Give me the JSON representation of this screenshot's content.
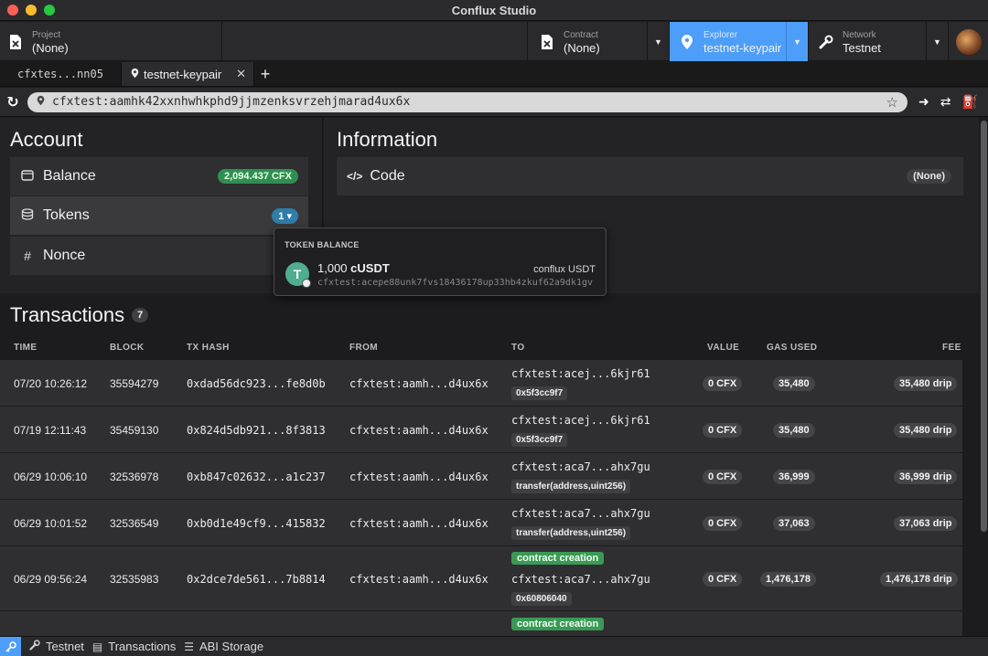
{
  "window": {
    "title": "Conflux Studio"
  },
  "toolbar": {
    "project_label": "Project",
    "project_value": "(None)",
    "contract_label": "Contract",
    "contract_value": "(None)",
    "explorer_label": "Explorer",
    "explorer_value": "testnet-keypair",
    "network_label": "Network",
    "network_value": "Testnet"
  },
  "tabs": [
    {
      "label": "cfxtes...nn05"
    },
    {
      "label": "testnet-keypair"
    }
  ],
  "address": {
    "value": "cfxtest:aamhk42xxnhwhkphd9jjmzenksvrzehjmarad4ux6x"
  },
  "account": {
    "title": "Account",
    "balance_label": "Balance",
    "balance_value": "2,094.437 CFX",
    "tokens_label": "Tokens",
    "tokens_value": "1",
    "nonce_label": "Nonce"
  },
  "information": {
    "title": "Information",
    "code_label": "Code",
    "code_value": "(None)"
  },
  "token_popup": {
    "header": "TOKEN BALANCE",
    "amount": "1,000",
    "symbol": "cUSDT",
    "name": "conflux USDT",
    "address": "cfxtest:acepe88unk7fvs18436178up33hb4zkuf62a9dk1gv"
  },
  "transactions": {
    "title": "Transactions",
    "count": "7",
    "columns": [
      "TIME",
      "BLOCK",
      "TX HASH",
      "FROM",
      "TO",
      "VALUE",
      "GAS USED",
      "FEE"
    ],
    "rows": [
      {
        "time": "07/20 10:26:12",
        "block": "35594279",
        "hash": "0xdad56dc923...fe8d0b",
        "from": "cfxtest:aamh...d4ux6x",
        "to": "cfxtest:acej...6kjr61",
        "method": "0x5f3cc9f7",
        "value": "0 CFX",
        "gas": "35,480",
        "fee": "35,480 drip"
      },
      {
        "time": "07/19 12:11:43",
        "block": "35459130",
        "hash": "0x824d5db921...8f3813",
        "from": "cfxtest:aamh...d4ux6x",
        "to": "cfxtest:acej...6kjr61",
        "method": "0x5f3cc9f7",
        "value": "0 CFX",
        "gas": "35,480",
        "fee": "35,480 drip"
      },
      {
        "time": "06/29 10:06:10",
        "block": "32536978",
        "hash": "0xb847c02632...a1c237",
        "from": "cfxtest:aamh...d4ux6x",
        "to": "cfxtest:aca7...ahx7gu",
        "method": "transfer(address,uint256)",
        "value": "0 CFX",
        "gas": "36,999",
        "fee": "36,999 drip"
      },
      {
        "time": "06/29 10:01:52",
        "block": "32536549",
        "hash": "0xb0d1e49cf9...415832",
        "from": "cfxtest:aamh...d4ux6x",
        "to": "cfxtest:aca7...ahx7gu",
        "method": "transfer(address,uint256)",
        "value": "0 CFX",
        "gas": "37,063",
        "fee": "37,063 drip"
      },
      {
        "time": "06/29 09:56:24",
        "block": "32535983",
        "hash": "0x2dce7de561...7b8814",
        "from": "cfxtest:aamh...d4ux6x",
        "to": "cfxtest:aca7...ahx7gu",
        "creation": "contract creation",
        "method": "0x60806040",
        "value": "0 CFX",
        "gas": "1,476,178",
        "fee": "1,476,178 drip"
      },
      {
        "creation": "contract creation"
      }
    ]
  },
  "statusbar": {
    "network": "Testnet",
    "transactions": "Transactions",
    "abi": "ABI Storage"
  },
  "icons": {
    "project": "file-x-icon",
    "contract": "file-x-icon",
    "explorer": "map-pin-icon",
    "network": "wrench-icon",
    "refresh": "refresh-icon",
    "star": "star-icon",
    "token": "tether-logo",
    "key": "key-icon"
  },
  "colors": {
    "accent": "#4d9ef8",
    "balance_badge": "#2f8f52",
    "tokens_badge": "#2f7ea8",
    "tag_green": "#3a9a55"
  }
}
